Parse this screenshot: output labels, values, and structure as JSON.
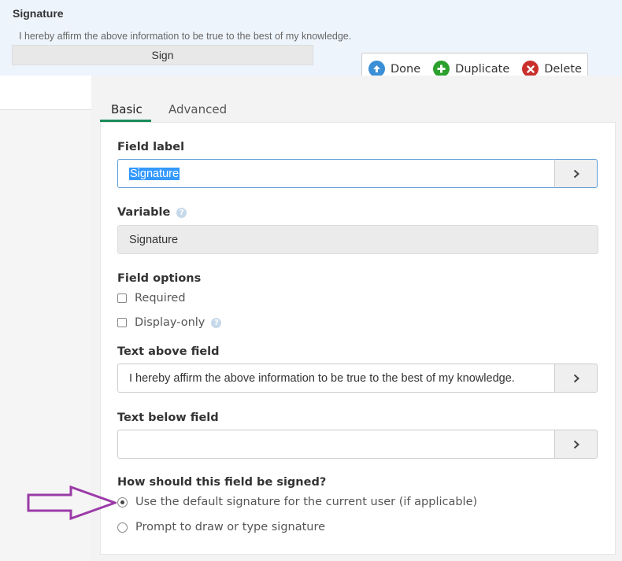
{
  "preview": {
    "title": "Signature",
    "text_above": "I hereby affirm the above information to be true to the best of my knowledge.",
    "sign_label": "Sign"
  },
  "toolbar": {
    "done_label": "Done",
    "duplicate_label": "Duplicate",
    "delete_label": "Delete"
  },
  "tabs": {
    "basic": "Basic",
    "advanced": "Advanced"
  },
  "field_label": {
    "label": "Field label",
    "value": "Signature"
  },
  "variable": {
    "label": "Variable",
    "value": "Signature"
  },
  "field_options": {
    "label": "Field options",
    "required": "Required",
    "display_only": "Display-only"
  },
  "text_above_field": {
    "label": "Text above field",
    "value": "I hereby affirm the above information to be true to the best of my knowledge."
  },
  "text_below_field": {
    "label": "Text below field",
    "value": ""
  },
  "signing": {
    "question": "How should this field be signed?",
    "option_default": "Use the default signature for the current user (if applicable)",
    "option_prompt": "Prompt to draw or type signature",
    "selected": "option_default"
  },
  "colors": {
    "accent_tab": "#1a8c5a",
    "done_icon": "#3a8fd6",
    "duplicate_icon": "#2ca02c",
    "delete_icon": "#c9302c",
    "annotation_arrow": "#9b3aa8"
  }
}
